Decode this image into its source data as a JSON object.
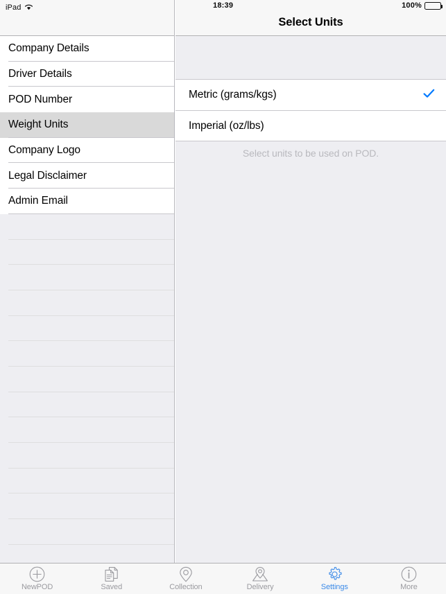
{
  "status_bar": {
    "device": "iPad",
    "wifi_icon": "wifi-icon",
    "time": "18:39",
    "battery_percent": "100%",
    "battery_icon": "battery-full-icon"
  },
  "colors": {
    "tint_blue": "#007AFF",
    "tab_active_blue": "#3b8ae8",
    "selected_row_gray": "#d9d9d9",
    "panel_background": "#eeeef2",
    "navbar_background": "#f7f7f7",
    "separator": "#c8c7cc",
    "footer_text": "#b9b9be"
  },
  "sidebar": {
    "items": [
      {
        "label": "Company Details",
        "selected": false
      },
      {
        "label": "Driver Details",
        "selected": false
      },
      {
        "label": "POD Number",
        "selected": false
      },
      {
        "label": "Weight Units",
        "selected": true
      },
      {
        "label": "Company Logo",
        "selected": false
      },
      {
        "label": "Legal Disclaimer",
        "selected": false
      },
      {
        "label": "Admin Email",
        "selected": false
      }
    ],
    "empty_row_count": 14
  },
  "detail": {
    "title": "Select Units",
    "options": [
      {
        "label": "Metric (grams/kgs)",
        "checked": true,
        "check_icon": "checkmark-icon"
      },
      {
        "label": "Imperial (oz/lbs)",
        "checked": false,
        "check_icon": "checkmark-icon"
      }
    ],
    "footer_note": "Select units to be used on POD."
  },
  "tab_bar": {
    "items": [
      {
        "label": "NewPOD",
        "icon": "plus-circle-icon",
        "active": false
      },
      {
        "label": "Saved",
        "icon": "documents-icon",
        "active": false
      },
      {
        "label": "Collection",
        "icon": "map-pin-icon",
        "active": false
      },
      {
        "label": "Delivery",
        "icon": "map-pin-route-icon",
        "active": false
      },
      {
        "label": "Settings",
        "icon": "gear-icon",
        "active": true
      },
      {
        "label": "More",
        "icon": "info-circle-icon",
        "active": false
      }
    ]
  }
}
